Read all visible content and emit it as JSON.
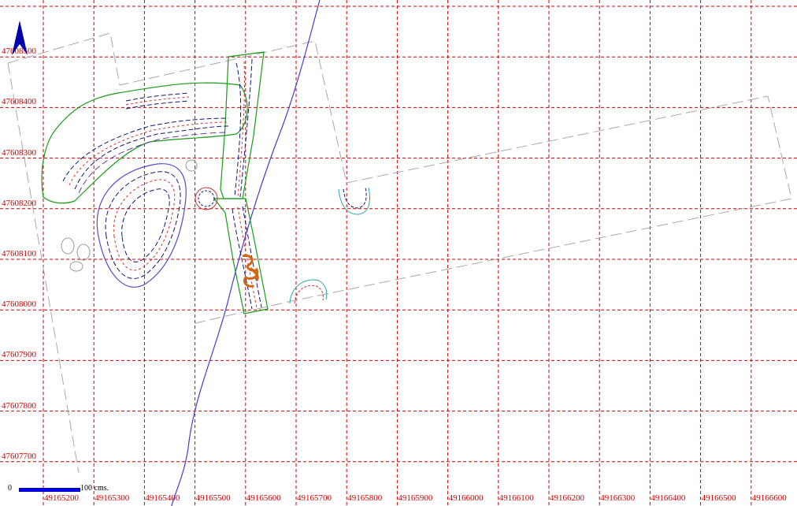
{
  "map": {
    "grid_color": "#cc0000",
    "x_labels": [
      "49165200",
      "49165300",
      "49165400",
      "49165500",
      "49165600",
      "49165700",
      "49165800",
      "49165900",
      "49166000",
      "49166100",
      "49166200",
      "49166300",
      "49166400",
      "49166500",
      "49166600"
    ],
    "y_labels": [
      "47608500",
      "47608400",
      "47608300",
      "47608200",
      "47608100",
      "47608000",
      "47607900",
      "47607800",
      "47607700"
    ],
    "north_arrow_icon": "north-arrow-icon",
    "scale": {
      "zero": "0",
      "unit": "100  cms."
    },
    "layer_colors": {
      "grid": "#cc0000",
      "boundary": "#999999",
      "river": "#3a32c8",
      "green_outline": "#1a9a1a",
      "contours_dark": "#141478",
      "contours_red": "#cc3333",
      "contours_purple": "#6a3aa8",
      "cyan": "#2aa6a6",
      "orange_feature": "#d2660f"
    }
  }
}
